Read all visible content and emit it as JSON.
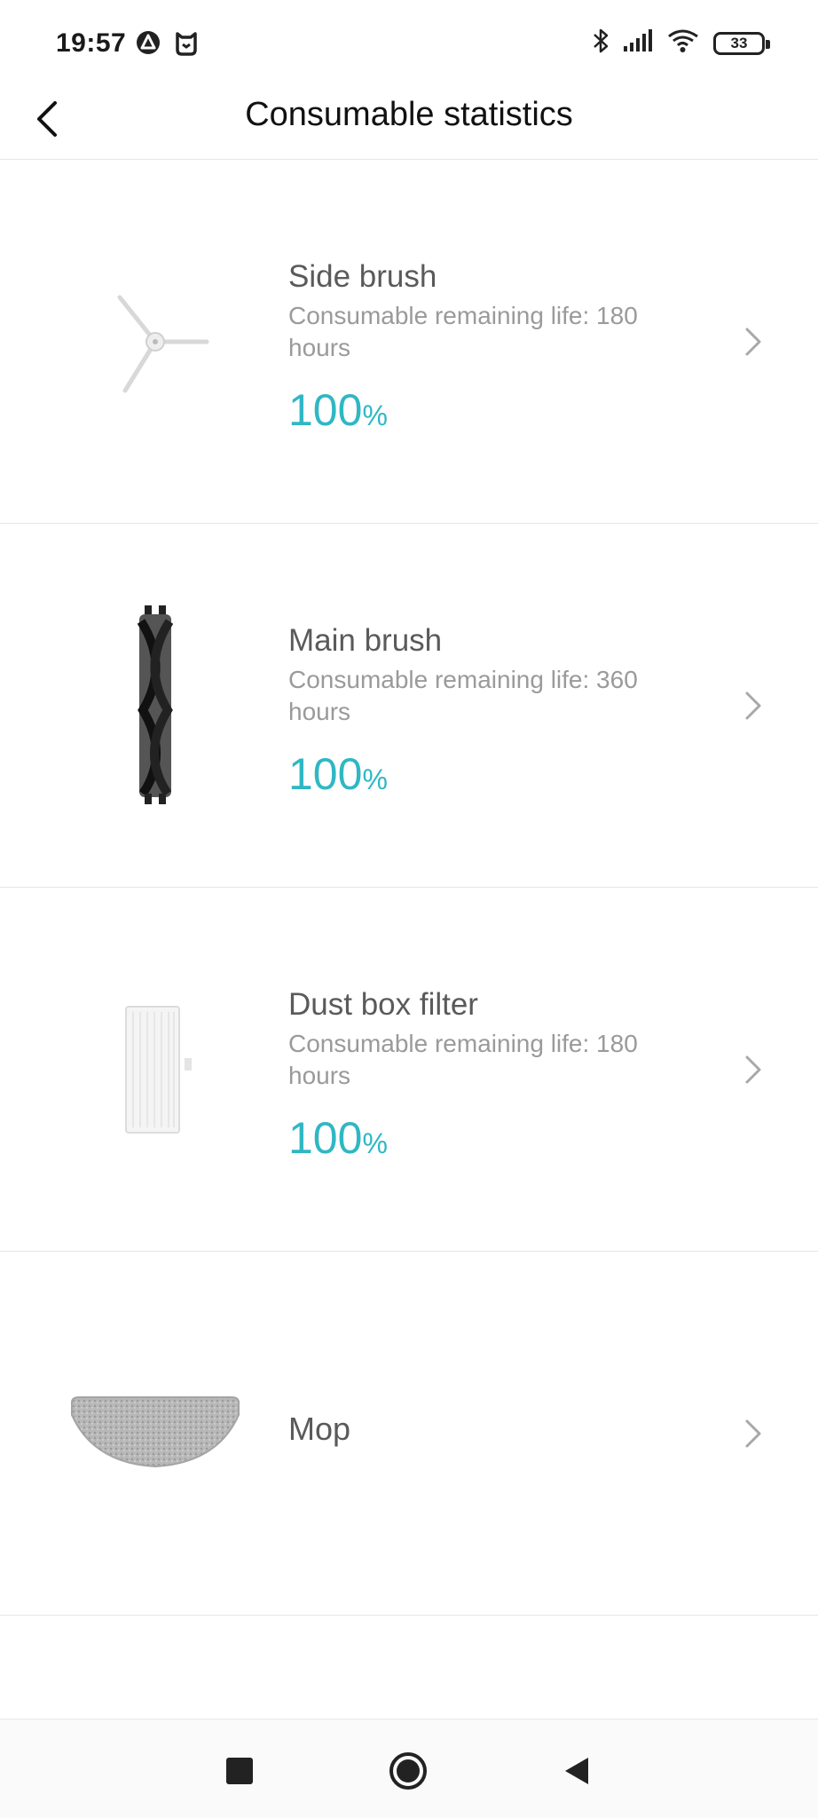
{
  "status_bar": {
    "time": "19:57",
    "left_icons": [
      "assistant-icon",
      "mi-home-icon"
    ],
    "right_icons": [
      "bluetooth-icon",
      "cell-signal-icon",
      "wifi-icon"
    ],
    "battery_level": "33"
  },
  "header": {
    "title": "Consumable statistics",
    "back_icon": "chevron-left-icon"
  },
  "accent_color": "#2fb7c4",
  "items": [
    {
      "name": "Side brush",
      "life": "Consumable remaining life: 180 hours",
      "percent": "100",
      "percent_sign": "%",
      "image": "side-brush-image"
    },
    {
      "name": "Main brush",
      "life": "Consumable remaining life: 360 hours",
      "percent": "100",
      "percent_sign": "%",
      "image": "main-brush-image"
    },
    {
      "name": "Dust box filter",
      "life": "Consumable remaining life: 180 hours",
      "percent": "100",
      "percent_sign": "%",
      "image": "filter-image"
    },
    {
      "name": "Mop",
      "image": "mop-image"
    }
  ],
  "nav": [
    "recents-square-icon",
    "home-circle-icon",
    "back-triangle-icon"
  ]
}
